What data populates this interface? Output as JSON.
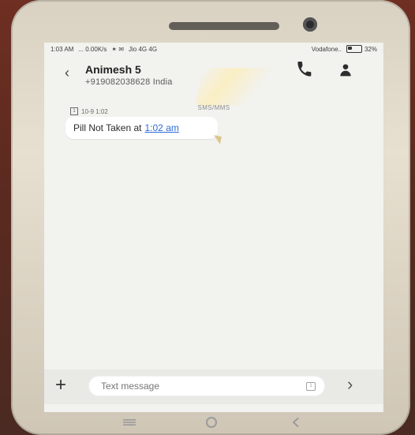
{
  "status_bar": {
    "time": "1:03 AM",
    "data_speed": "... 0.00K/s",
    "carrier1": "Jio 4G 4G",
    "carrier2": "Vodafone..",
    "battery": "32%"
  },
  "header": {
    "contact_name": "Animesh 5",
    "contact_number": "+919082038628 India",
    "channel_label": "SMS/MMS"
  },
  "messages": [
    {
      "timestamp": "10-9 1:02",
      "sim_slot": "1",
      "text_prefix": "Pill Not Taken at",
      "time_link": "1:02 am"
    }
  ],
  "composer": {
    "placeholder": "Text message",
    "sim_indicator": "1"
  }
}
